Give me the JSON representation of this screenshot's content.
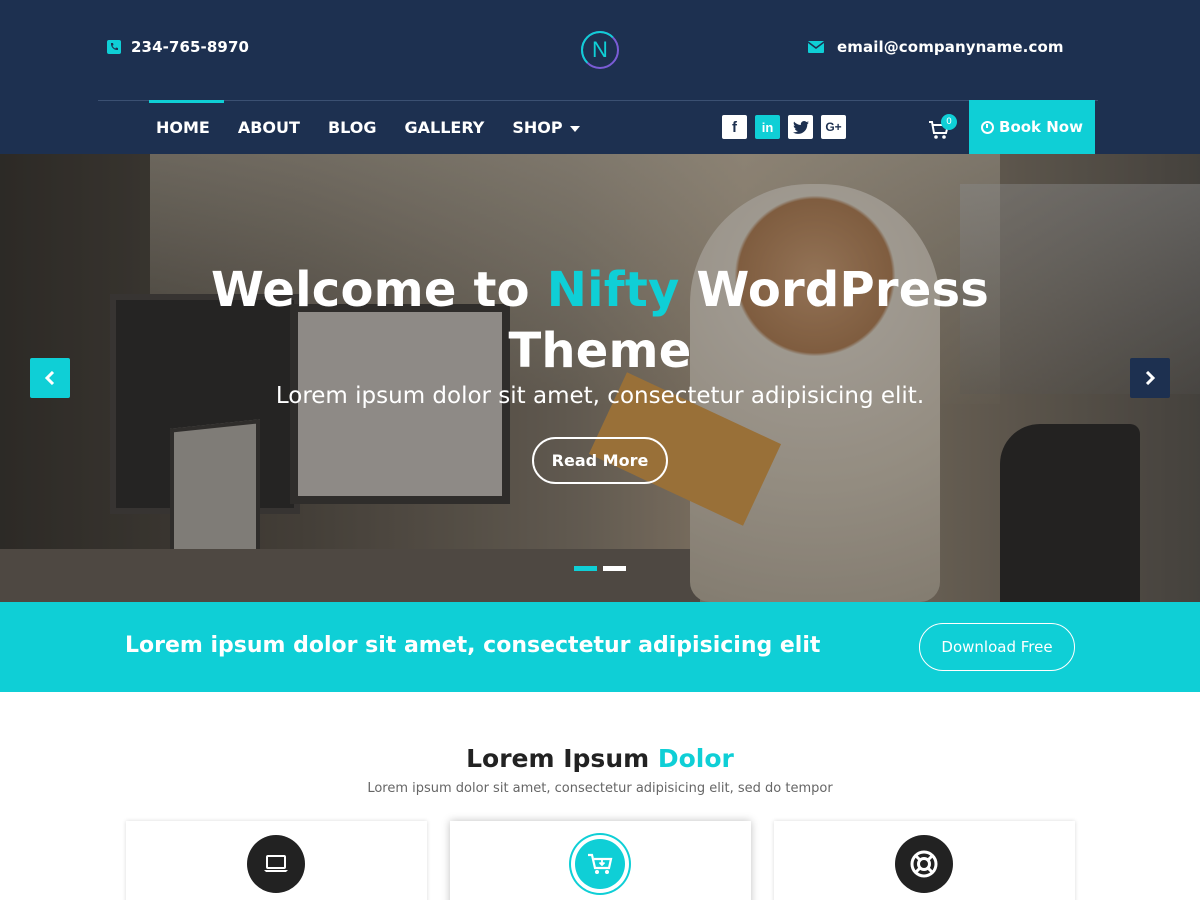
{
  "header": {
    "phone": "234-765-8970",
    "email": "email@companyname.com",
    "logo_letter": "N"
  },
  "nav": {
    "items": [
      {
        "label": "HOME",
        "active": true
      },
      {
        "label": "ABOUT"
      },
      {
        "label": "BLOG"
      },
      {
        "label": "GALLERY"
      },
      {
        "label": "SHOP",
        "has_dropdown": true
      }
    ]
  },
  "social": {
    "facebook": "f",
    "linkedin": "in",
    "twitter": "twitter-icon",
    "googleplus": "G+"
  },
  "cart": {
    "count": "0"
  },
  "book_button": {
    "label": "Book Now"
  },
  "hero": {
    "title_before": "Welcome to ",
    "title_accent": "Nifty",
    "title_after": " WordPress Theme",
    "subtitle": "Lorem ipsum dolor sit amet, consectetur adipisicing elit.",
    "button_label": "Read More",
    "slides": 2,
    "active_slide": 1
  },
  "cta": {
    "text": "Lorem ipsum dolor sit amet, consectetur adipisicing elit",
    "button_label": "Download Free"
  },
  "section": {
    "title_before": "Lorem Ipsum ",
    "title_accent": "Dolor",
    "subtitle": "Lorem ipsum dolor sit amet, consectetur adipisicing elit, sed do tempor"
  },
  "cards": [
    {
      "icon": "laptop-icon"
    },
    {
      "icon": "shopping-cart-icon"
    },
    {
      "icon": "life-ring-icon"
    }
  ],
  "colors": {
    "navy": "#1d3050",
    "accent": "#0fcfd6",
    "white": "#ffffff"
  }
}
